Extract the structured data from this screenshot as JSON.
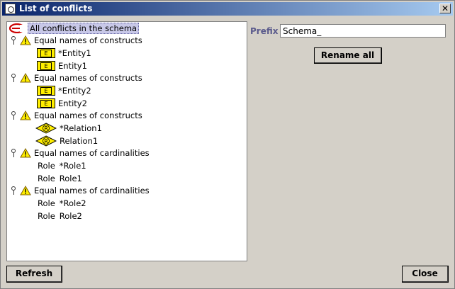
{
  "window": {
    "title": "List of conflicts"
  },
  "tree": {
    "root_label": "All conflicts in the schema",
    "groups": [
      {
        "label": "Equal names of constructs",
        "kind": "entity",
        "items": [
          {
            "label": "*Entity1"
          },
          {
            "label": "Entity1"
          }
        ]
      },
      {
        "label": "Equal names of constructs",
        "kind": "entity",
        "items": [
          {
            "label": "*Entity2"
          },
          {
            "label": "Entity2"
          }
        ]
      },
      {
        "label": "Equal names of constructs",
        "kind": "relation",
        "items": [
          {
            "label": "*Relation1"
          },
          {
            "label": "Relation1"
          }
        ]
      },
      {
        "label": "Equal names of cardinalities",
        "kind": "role",
        "items": [
          {
            "tag": "Role",
            "label": "*Role1"
          },
          {
            "tag": "Role",
            "label": "Role1"
          }
        ]
      },
      {
        "label": "Equal names of cardinalities",
        "kind": "role",
        "items": [
          {
            "tag": "Role",
            "label": "*Role2"
          },
          {
            "tag": "Role",
            "label": "Role2"
          }
        ]
      }
    ],
    "entity_icon_letter": "E",
    "relation_icon_letter": "R"
  },
  "prefix": {
    "label": "Prefix",
    "value": "Schema_"
  },
  "buttons": {
    "rename_all": "Rename all",
    "refresh": "Refresh",
    "close": "Close"
  },
  "colors": {
    "titlebar_start": "#0a246a",
    "titlebar_end": "#a6caf0",
    "entity_icon": "#ffee00",
    "warning": "#ffee00",
    "selection": "#c8c8e8"
  }
}
